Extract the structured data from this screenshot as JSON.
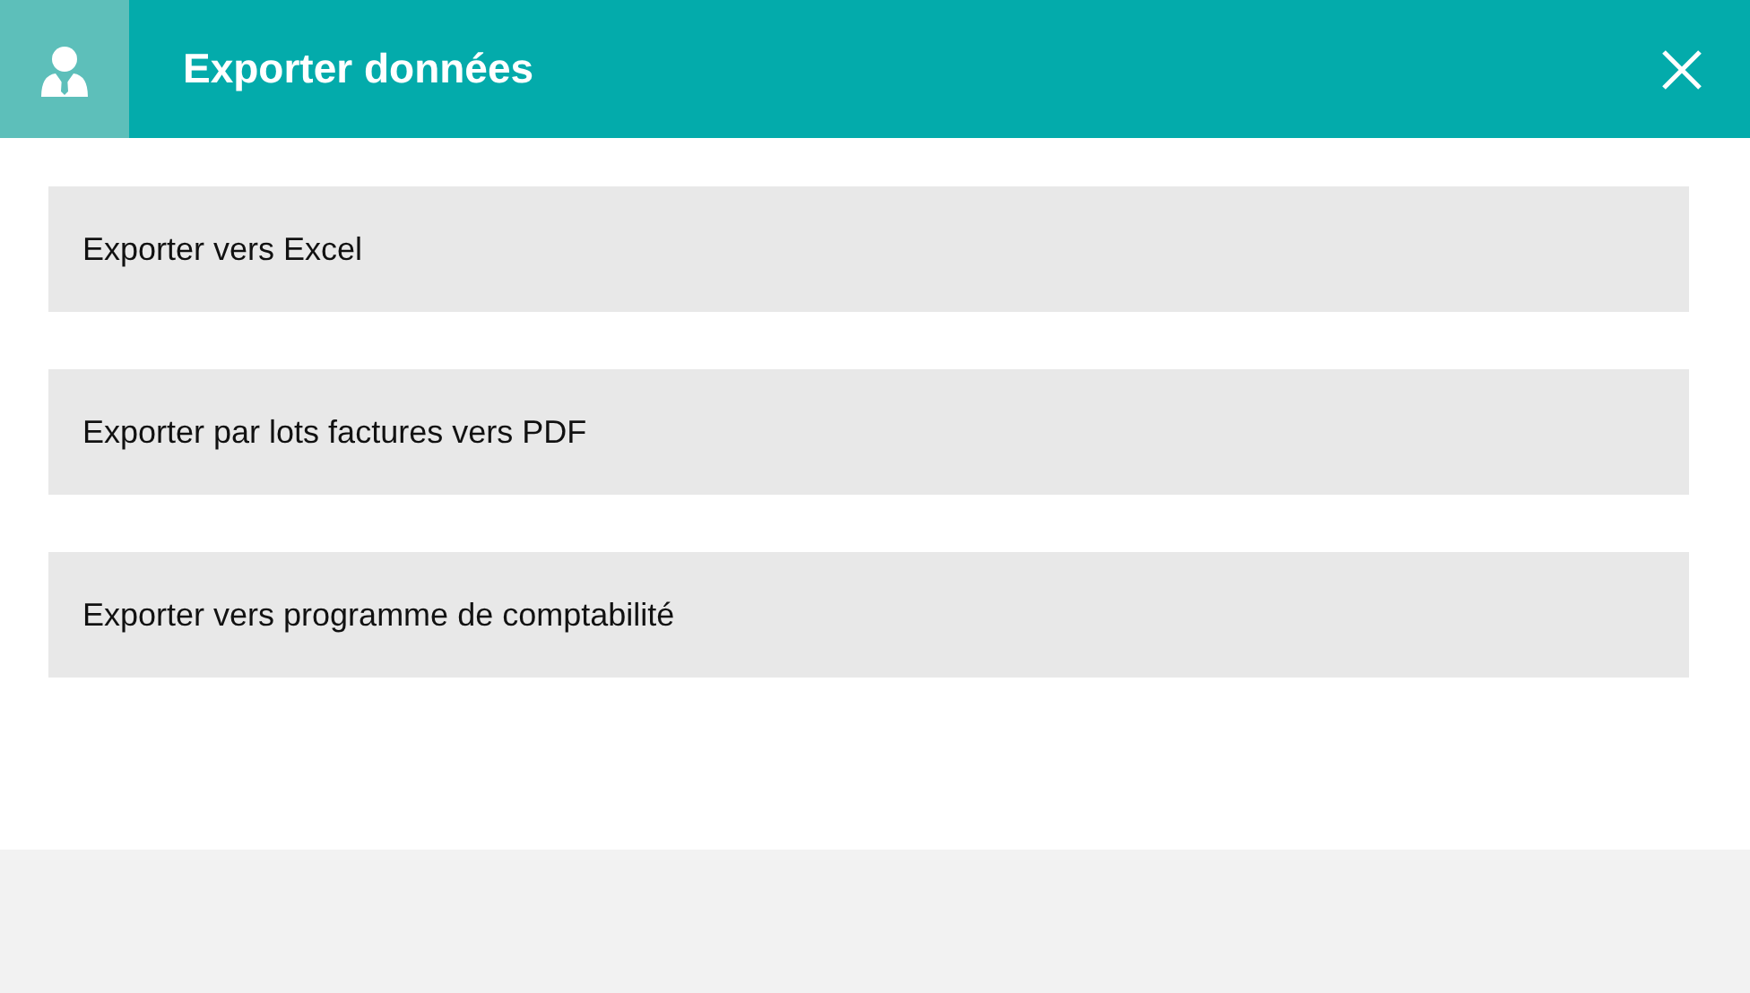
{
  "header": {
    "title": "Exporter données"
  },
  "options": [
    {
      "label": "Exporter vers Excel"
    },
    {
      "label": "Exporter par lots factures vers PDF"
    },
    {
      "label": "Exporter vers programme de comptabilité"
    }
  ]
}
